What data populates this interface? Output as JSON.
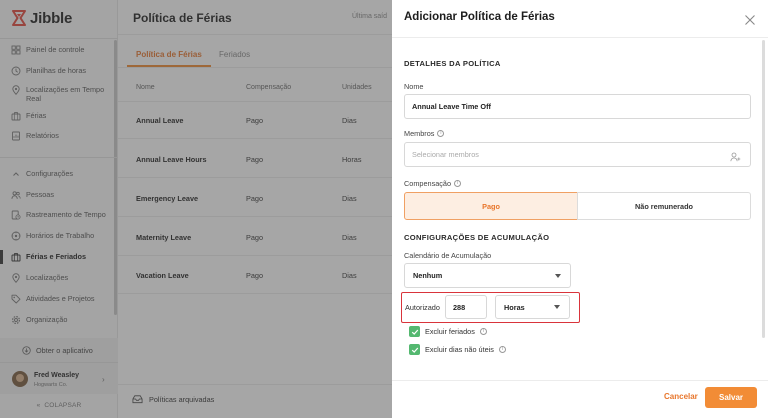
{
  "app": {
    "name": "Jibble"
  },
  "sidebar": {
    "items": [
      {
        "label": "Painel de controle",
        "icon": "dashboard-icon"
      },
      {
        "label": "Planilhas de horas",
        "icon": "clock-icon"
      },
      {
        "label": "Localizações em Tempo Real",
        "icon": "location-pin-icon"
      },
      {
        "label": "Férias",
        "icon": "suitcase-icon"
      },
      {
        "label": "Relatórios",
        "icon": "report-icon"
      }
    ],
    "config_label": "Configurações",
    "config_items": [
      {
        "label": "Pessoas",
        "icon": "people-icon"
      },
      {
        "label": "Rastreamento de Tempo",
        "icon": "time-tracking-icon"
      },
      {
        "label": "Horários de Trabalho",
        "icon": "schedule-icon"
      },
      {
        "label": "Férias e Feriados",
        "icon": "suitcase-icon",
        "active": true
      },
      {
        "label": "Localizações",
        "icon": "location-pin-icon"
      },
      {
        "label": "Atividades e Projetos",
        "icon": "tag-icon"
      },
      {
        "label": "Organização",
        "icon": "gear-icon"
      }
    ],
    "get_app": "Obter o aplicativo",
    "user": {
      "name": "Fred Weasley",
      "org": "Hogwarts Co."
    },
    "collapse": "COLAPSAR"
  },
  "main": {
    "title": "Política de Férias",
    "subtitle": "Última saíd",
    "tabs": [
      {
        "label": "Política de Férias",
        "active": true
      },
      {
        "label": "Feriados",
        "active": false
      }
    ],
    "columns": [
      "Nome",
      "Compensação",
      "Unidades"
    ],
    "rows": [
      {
        "name": "Annual Leave",
        "comp": "Pago",
        "unit": "Dias"
      },
      {
        "name": "Annual Leave Hours",
        "comp": "Pago",
        "unit": "Horas"
      },
      {
        "name": "Emergency Leave",
        "comp": "Pago",
        "unit": "Dias"
      },
      {
        "name": "Maternity Leave",
        "comp": "Pago",
        "unit": "Dias"
      },
      {
        "name": "Vacation Leave",
        "comp": "Pago",
        "unit": "Dias"
      }
    ],
    "archived": "Políticas arquivadas"
  },
  "panel": {
    "title": "Adicionar Política de Férias",
    "section_details": "DETALHES DA POLÍTICA",
    "name_label": "Nome",
    "name_value": "Annual Leave Time Off",
    "members_label": "Membros",
    "members_placeholder": "Selecionar membros",
    "comp_label": "Compensação",
    "comp_paid": "Pago",
    "comp_unpaid": "Não remunerado",
    "section_accrual": "CONFIGURAÇÕES DE ACUMULAÇÃO",
    "calendar_label": "Calendário de Acumulação",
    "calendar_value": "Nenhum",
    "authorized_label": "Autorizado",
    "authorized_value": "288",
    "unit_value": "Horas",
    "exclude_holidays": "Excluir feriados",
    "exclude_nonworking": "Excluir dias não úteis",
    "cancel": "Cancelar",
    "save": "Salvar"
  },
  "colors": {
    "accent": "#f28c36",
    "accent_text": "#e8762c",
    "highlight": "#d9343b",
    "check": "#54b870"
  }
}
